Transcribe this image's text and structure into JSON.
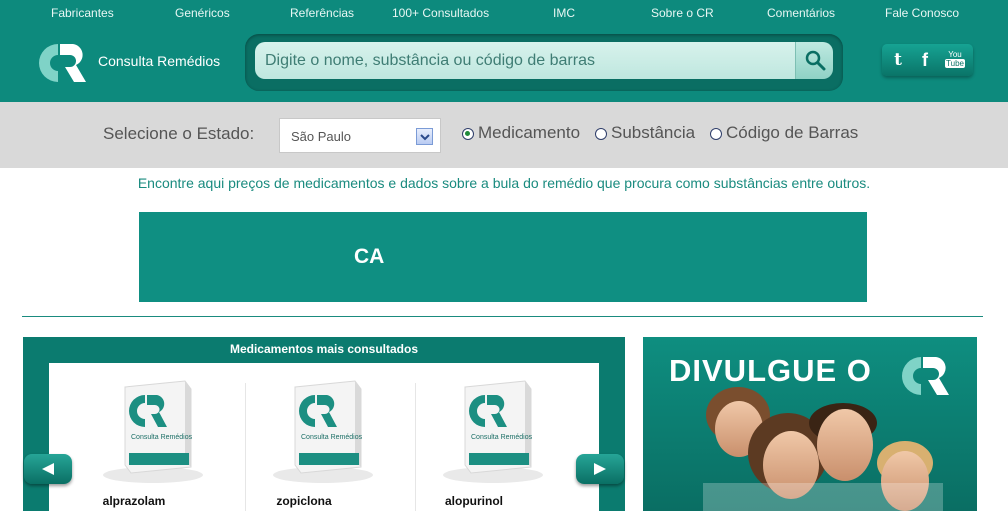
{
  "nav": {
    "items": [
      "Fabricantes",
      "Genéricos",
      "Referências",
      "100+ Consultados",
      "IMC",
      "Sobre o CR",
      "Comentários",
      "Fale Conosco"
    ]
  },
  "logo": {
    "text": "Consulta Remédios"
  },
  "search": {
    "placeholder": "Digite o nome, substância ou código de barras"
  },
  "social": {
    "youtube_line1": "You",
    "youtube_line2": "Tube"
  },
  "state": {
    "label": "Selecione o Estado:",
    "selected": "São Paulo"
  },
  "search_type": {
    "options": [
      {
        "label": "Medicamento",
        "selected": true
      },
      {
        "label": "Substância",
        "selected": false
      },
      {
        "label": "Código de Barras",
        "selected": false
      }
    ]
  },
  "intro": "Encontre aqui preços de medicamentos e dados sobre a bula do remédio que procura como substâncias entre outros.",
  "banner": {
    "text": "CA"
  },
  "most_consulted": {
    "title": "Medicamentos mais consultados",
    "items": [
      {
        "name": "alprazolam"
      },
      {
        "name": "zopiclona"
      },
      {
        "name": "alopurinol"
      }
    ],
    "box_label": "Consulta Remédios"
  },
  "promo": {
    "title": "DIVULGUE O"
  },
  "colors": {
    "brand": "#0d8a7d",
    "brand_dark": "#0a6e63",
    "state_bar": "#d9d9d9",
    "text_teal": "#1a8b7f"
  }
}
